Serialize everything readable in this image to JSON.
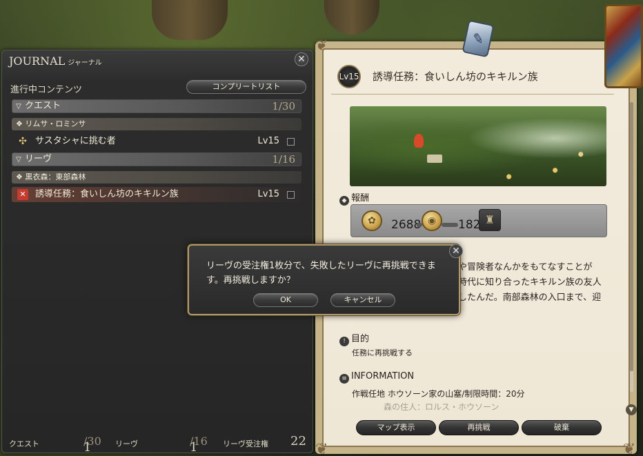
{
  "journal": {
    "title": "JOURNAL",
    "title_jp": "ジャーナル",
    "section_label": "進行中コンテンツ",
    "complete_list_button": "コンプリートリスト",
    "categories": [
      {
        "name": "クエスト",
        "count": "1/30",
        "region": "❖ リムサ・ロミンサ",
        "entries": [
          {
            "label": "サスタシャに挑む者",
            "level": "Lv15",
            "icon": "quest-icon"
          }
        ]
      },
      {
        "name": "リーヴ",
        "count": "1/16",
        "region": "❖ 黒衣森：東部森林",
        "entries": [
          {
            "label": "誘導任務：食いしん坊のキキルン族",
            "level": "Lv15",
            "icon": "leve-failed-icon"
          }
        ]
      }
    ],
    "footer": {
      "quest_label": "クエスト",
      "quest_count": "1",
      "quest_max": "/30",
      "leve_label": "リーヴ",
      "leve_count": "1",
      "leve_max": "/16",
      "allowance_label": "リーヴ受注権",
      "allowance_value": "22"
    }
  },
  "detail": {
    "level_badge": "Lv15",
    "title": "誘導任務：食いしん坊のキキルン族",
    "reward_heading": "報酬",
    "rewards": {
      "exp": "2688",
      "gil": "182"
    },
    "description_lines": [
      "や冒険者なんかをもてなすことが",
      "時代に知り合ったキキルン族の友人",
      "したんだ。南部森林の入口まで、迎"
    ],
    "objective_heading": "目的",
    "objective_text": "任務に再挑戦する",
    "info_heading": "INFORMATION",
    "info_line": "作戦任地 ホウソーン家の山塞/制限時間：20分",
    "info_line_faded": "森の住人：ロルス・ホウソーン",
    "buttons": {
      "map": "マップ表示",
      "retry": "再挑戦",
      "abandon": "破棄"
    }
  },
  "dialog": {
    "message": "リーヴの受注権1枚分で、失敗したリーヴに再挑戦できます。再挑戦しますか？",
    "ok": "OK",
    "cancel": "キャンセル"
  }
}
